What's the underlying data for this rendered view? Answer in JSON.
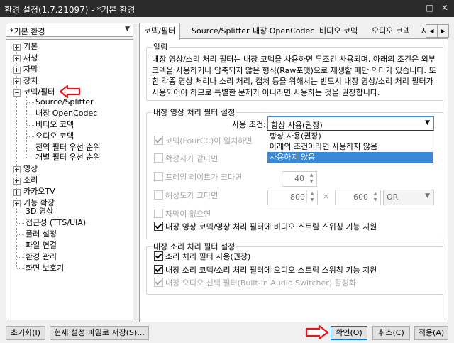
{
  "window": {
    "title": "환경 설정(1.7.21097) - *기본 환경",
    "controls": [
      "□",
      "✕"
    ]
  },
  "profile": {
    "selected": "*기본 환경"
  },
  "tree": {
    "items": [
      "기본",
      "재생",
      "자막",
      "장치",
      "코덱/필터"
    ],
    "codec_children": [
      "Source/Splitter",
      "내장 OpenCodec",
      "비디오 코덱",
      "오디오 코덱",
      "전역 필터 우선 순위",
      "개별 필터 우선 순위"
    ],
    "more_items": [
      "영상",
      "소리",
      "카카오TV",
      "기능 확장",
      "3D 영상",
      "접근성 (TTS/UIA)",
      "플러 설정",
      "파일 연결",
      "환경 관리",
      "화면 보호기"
    ]
  },
  "tabs": [
    "코덱/필터",
    "Source/Splitter",
    "내장 OpenCodec",
    "비디오 코덱",
    "오디오 코덱",
    "자"
  ],
  "notice": {
    "legend": "알림",
    "text": "내장 영상/소리 처리 필터는 내장 코덱을 사용하면 무조건 사용되며, 아래의 조건은 외부 코덱을 사용하거나 압축되지 않은 형식(Raw포맷)으로 재생할 때만 의미가 있습니다. 또한 각종 영상 처리나 소리 처리, 캡처 등을 위해서는 반드시 내장 영상/소리 처리 필터가 사용되어야 하므로 특별한 문제가 아니라면 사용하는 것을 권장합니다."
  },
  "video_filter": {
    "legend": "내장 영상 처리 필터 설정",
    "use_condition_label": "사용 조건:",
    "use_condition_value": "항상 사용(권장)",
    "options": [
      "항상 사용(권장)",
      "아래의 조건이라면 사용하지 않음",
      "사용하지 않음"
    ],
    "fourcc_label": "코덱(FourCC)이 일치하면",
    "ext_label": "확장자가 같다면",
    "fps_label": "프레임 레이트가 크다면",
    "fps_value": "40",
    "res_label": "해상도가 크다면",
    "res_w": "800",
    "res_times": "×",
    "res_h": "600",
    "res_op": "OR",
    "nosub_label": "자막이 없으면",
    "switch_label": "내장 영상 코덱/영상 처리 필터에  비디오 스트림 스위칭 기능 지원"
  },
  "audio_filter": {
    "legend": "내장 소리 처리 필터 설정",
    "use_label": "소리 처리 필터 사용(권장)",
    "switch_label": "내장 소리 코덱/소리 처리 필터에  오디오 스트림 스위칭 기능 지원",
    "switcher_label": "내장 오디오 선택 필터(Built-in Audio Switcher) 활성화"
  },
  "buttons": {
    "reset": "초기화(I)",
    "save_current": "현재 설정 파일로 저장(S)...",
    "ok": "확인(O)",
    "cancel": "취소(C)",
    "apply": "적용(A)"
  },
  "colors": {
    "accent": "#3a89d9",
    "annotation": "#e0161b"
  }
}
